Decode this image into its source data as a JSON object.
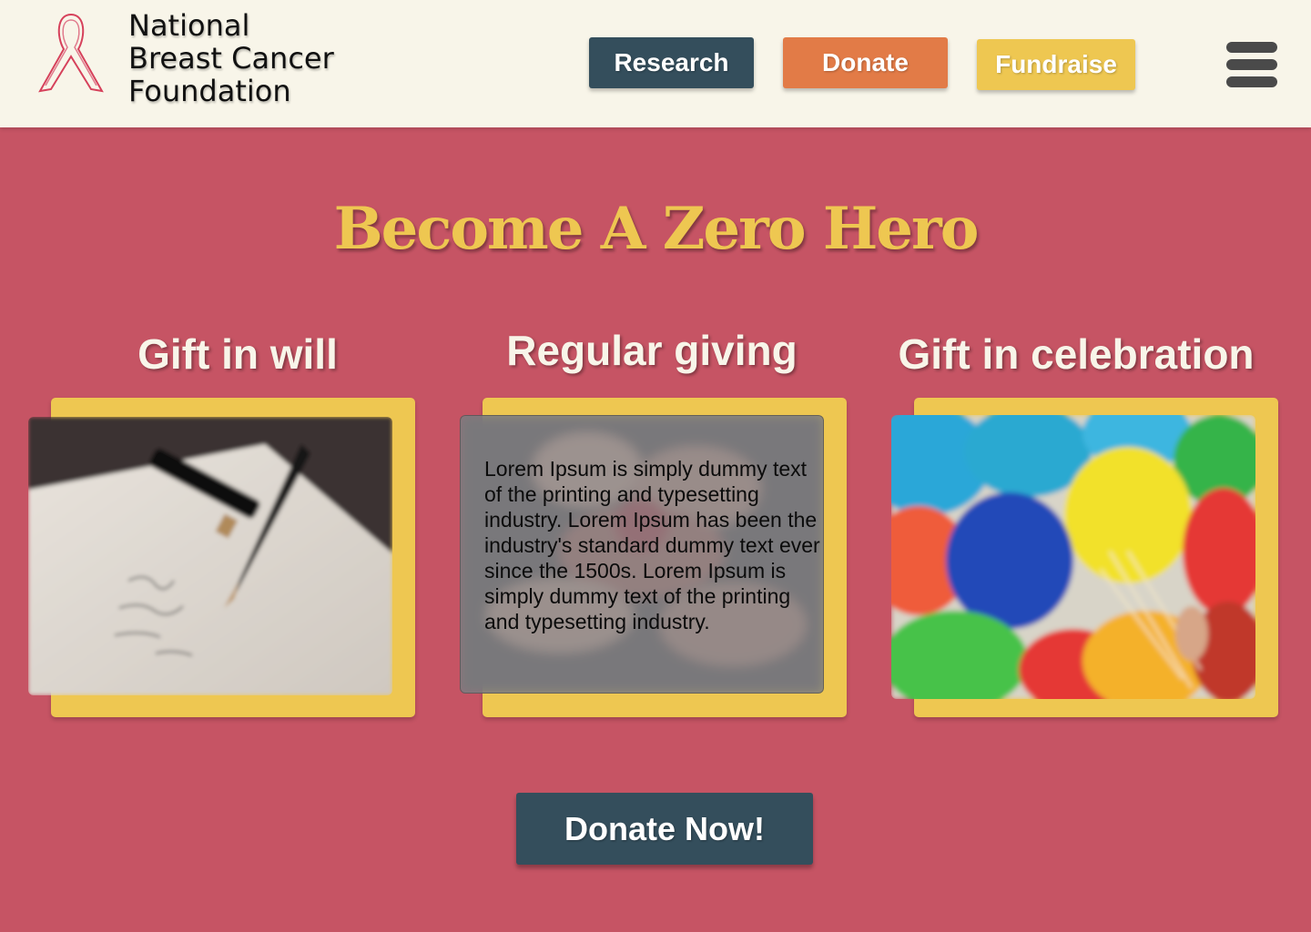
{
  "header": {
    "org_name_lines": [
      "National",
      "Breast Cancer",
      "Foundation"
    ],
    "logo_icon": "pink-ribbon-icon",
    "nav": {
      "research": "Research",
      "donate": "Donate",
      "fundraise": "Fundraise"
    },
    "menu_icon": "hamburger-menu-icon"
  },
  "hero": {
    "title": "Become A Zero Hero"
  },
  "cards": [
    {
      "title": "Gift in will",
      "image": "pen-and-letter-image"
    },
    {
      "title": "Regular giving",
      "image": "hands-together-image",
      "text": "Lorem Ipsum is simply dummy text of the printing and typesetting industry. Lorem Ipsum has been the industry's standard dummy text ever since the 1500s. Lorem Ipsum is simply dummy text of the printing and typesetting industry."
    },
    {
      "title": "Gift in celebration",
      "image": "balloons-image"
    }
  ],
  "cta": {
    "label": "Donate Now!"
  },
  "colors": {
    "page_bg": "#c65464",
    "header_bg": "#f8f5e9",
    "research": "#344e5c",
    "donate": "#e27b47",
    "fundraise": "#eec751",
    "card_frame": "#eec751",
    "title_accent": "#eec751"
  }
}
